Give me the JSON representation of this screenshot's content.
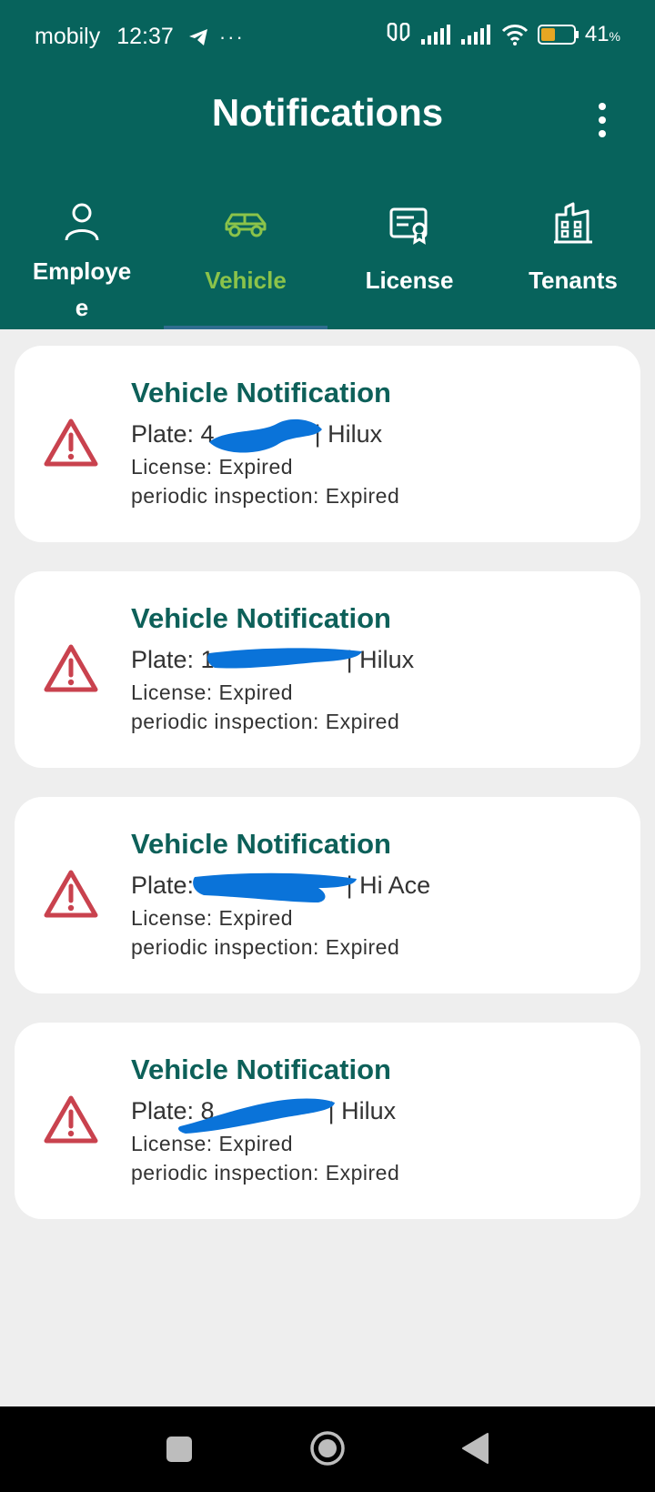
{
  "status": {
    "carrier": "mobily",
    "time": "12:37",
    "more": "···",
    "battery_level": "41",
    "battery_unit": "%"
  },
  "app": {
    "title": "Notifications"
  },
  "tabs": [
    {
      "label": "Employe\ne",
      "icon": "person-icon",
      "active": false
    },
    {
      "label": "Vehicle",
      "icon": "car-icon",
      "active": true
    },
    {
      "label": "License",
      "icon": "license-icon",
      "active": false
    },
    {
      "label": "Tenants",
      "icon": "building-icon",
      "active": false
    }
  ],
  "notifications": [
    {
      "title": "Vehicle Notification",
      "plate_prefix": "Plate: 4",
      "plate_suffix": "| Hilux",
      "license": "License: Expired",
      "periodic": "periodic inspection: Expired"
    },
    {
      "title": "Vehicle Notification",
      "plate_prefix": "Plate: 1",
      "plate_suffix": "| Hilux",
      "license": "License: Expired",
      "periodic": "periodic inspection: Expired"
    },
    {
      "title": "Vehicle Notification",
      "plate_prefix": "Plate: d",
      "plate_suffix": "| Hi Ace",
      "license": "License: Expired",
      "periodic": "periodic inspection: Expired"
    },
    {
      "title": "Vehicle Notification",
      "plate_prefix": "Plate: 8",
      "plate_suffix": "| Hilux",
      "license": "License: Expired",
      "periodic": "periodic inspection: Expired"
    }
  ],
  "colors": {
    "header_bg": "#07635c",
    "active_tab": "#8bc34a",
    "card_title": "#0d6059",
    "warning": "#c9424e",
    "redaction": "#0a73d9"
  }
}
